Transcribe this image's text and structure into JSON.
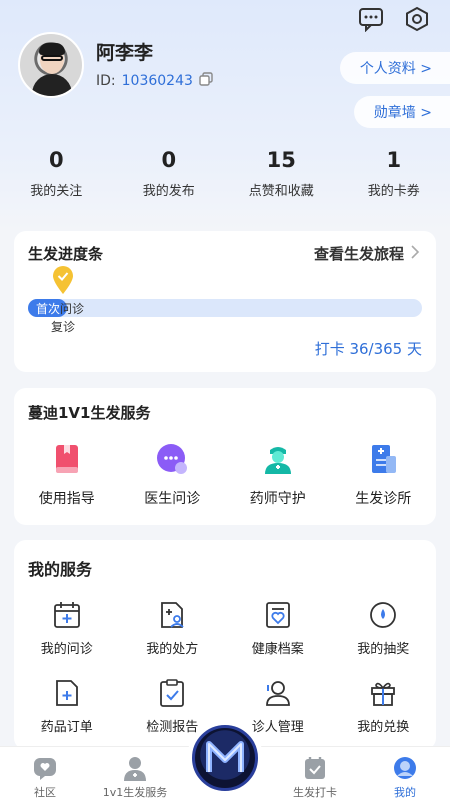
{
  "profile": {
    "name": "阿李李",
    "id_label": "ID:",
    "id_value": "10360243",
    "profile_button": "个人资料 >",
    "badge_button": "勋章墙 >"
  },
  "stats": [
    {
      "value": "0",
      "label": "我的关注"
    },
    {
      "value": "0",
      "label": "我的发布"
    },
    {
      "value": "15",
      "label": "点赞和收藏"
    },
    {
      "value": "1",
      "label": "我的卡券"
    }
  ],
  "progress": {
    "title": "生发进度条",
    "link": "查看生发旅程",
    "stage1_a": "首次",
    "stage1_b": "问诊",
    "stage2": "复诊",
    "checkin": "打卡 36/365 天",
    "fill_fraction": 0.0986
  },
  "service": {
    "title": "蔓迪1V1生发服务",
    "items": [
      {
        "label": "使用指导",
        "icon": "guide-book-icon"
      },
      {
        "label": "医生问诊",
        "icon": "chat-bubble-icon"
      },
      {
        "label": "药师守护",
        "icon": "pharmacist-icon"
      },
      {
        "label": "生发诊所",
        "icon": "clinic-icon"
      }
    ]
  },
  "my_services": {
    "title": "我的服务",
    "row1": [
      {
        "label": "我的问诊",
        "icon": "calendar-plus-icon"
      },
      {
        "label": "我的处方",
        "icon": "prescription-icon"
      },
      {
        "label": "健康档案",
        "icon": "health-record-icon"
      },
      {
        "label": "我的抽奖",
        "icon": "lottery-icon"
      }
    ],
    "row2": [
      {
        "label": "药品订单",
        "icon": "medicine-order-icon"
      },
      {
        "label": "检测报告",
        "icon": "report-icon"
      },
      {
        "label": "诊人管理",
        "icon": "patient-manage-icon"
      },
      {
        "label": "我的兑换",
        "icon": "gift-icon"
      }
    ]
  },
  "tabbar": [
    {
      "label": "社区",
      "icon": "community-icon"
    },
    {
      "label": "1v1生发服务",
      "icon": "doctor-icon"
    },
    {
      "label": "",
      "icon": "m-logo-icon"
    },
    {
      "label": "生发打卡",
      "icon": "checkin-icon"
    },
    {
      "label": "我的",
      "icon": "mine-icon"
    }
  ],
  "colors": {
    "accent": "#2f6fd8",
    "progress_fill": "#3d7bea",
    "pin": "#f5c233"
  }
}
